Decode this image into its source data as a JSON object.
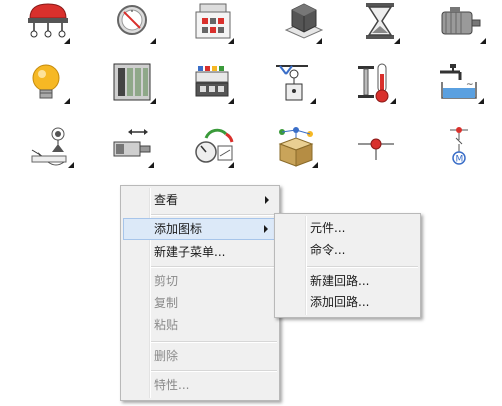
{
  "palette": {
    "icons": [
      {
        "name": "button-icon"
      },
      {
        "name": "meter-gauge-icon"
      },
      {
        "name": "connector-icon"
      },
      {
        "name": "sensor-block-icon"
      },
      {
        "name": "hourglass-icon"
      },
      {
        "name": "motor-icon"
      },
      {
        "name": "light-bulb-icon"
      },
      {
        "name": "plc-rack-icon"
      },
      {
        "name": "terminal-block-icon"
      },
      {
        "name": "hoist-icon"
      },
      {
        "name": "thermometer-icon"
      },
      {
        "name": "valve-tank-icon"
      },
      {
        "name": "antenna-switch-icon"
      },
      {
        "name": "cylinder-actuator-icon"
      },
      {
        "name": "gauge-panel-icon"
      },
      {
        "name": "network-box-icon"
      },
      {
        "name": "connection-point-icon"
      },
      {
        "name": "motor-circuit-icon"
      }
    ]
  },
  "context_menu": {
    "items": [
      {
        "label": "查看",
        "enabled": true,
        "submenu": true
      },
      {
        "label": "添加图标",
        "enabled": true,
        "submenu": true,
        "highlighted": true
      },
      {
        "label": "新建子菜单...",
        "enabled": true
      },
      {
        "label": "剪切",
        "enabled": false
      },
      {
        "label": "复制",
        "enabled": false
      },
      {
        "label": "粘贴",
        "enabled": false
      },
      {
        "label": "删除",
        "enabled": false
      },
      {
        "label": "特性...",
        "enabled": false
      }
    ]
  },
  "submenu": {
    "items": [
      {
        "label": "元件..."
      },
      {
        "label": "命令..."
      },
      {
        "label": "新建回路..."
      },
      {
        "label": "添加回路..."
      }
    ]
  },
  "colors": {
    "menu_bg": "#f0f0f0",
    "highlight": "#dce9f8",
    "highlight_border": "#a7c5ea",
    "disabled_text": "#8a8a8a",
    "icon_red": "#d9302c"
  }
}
